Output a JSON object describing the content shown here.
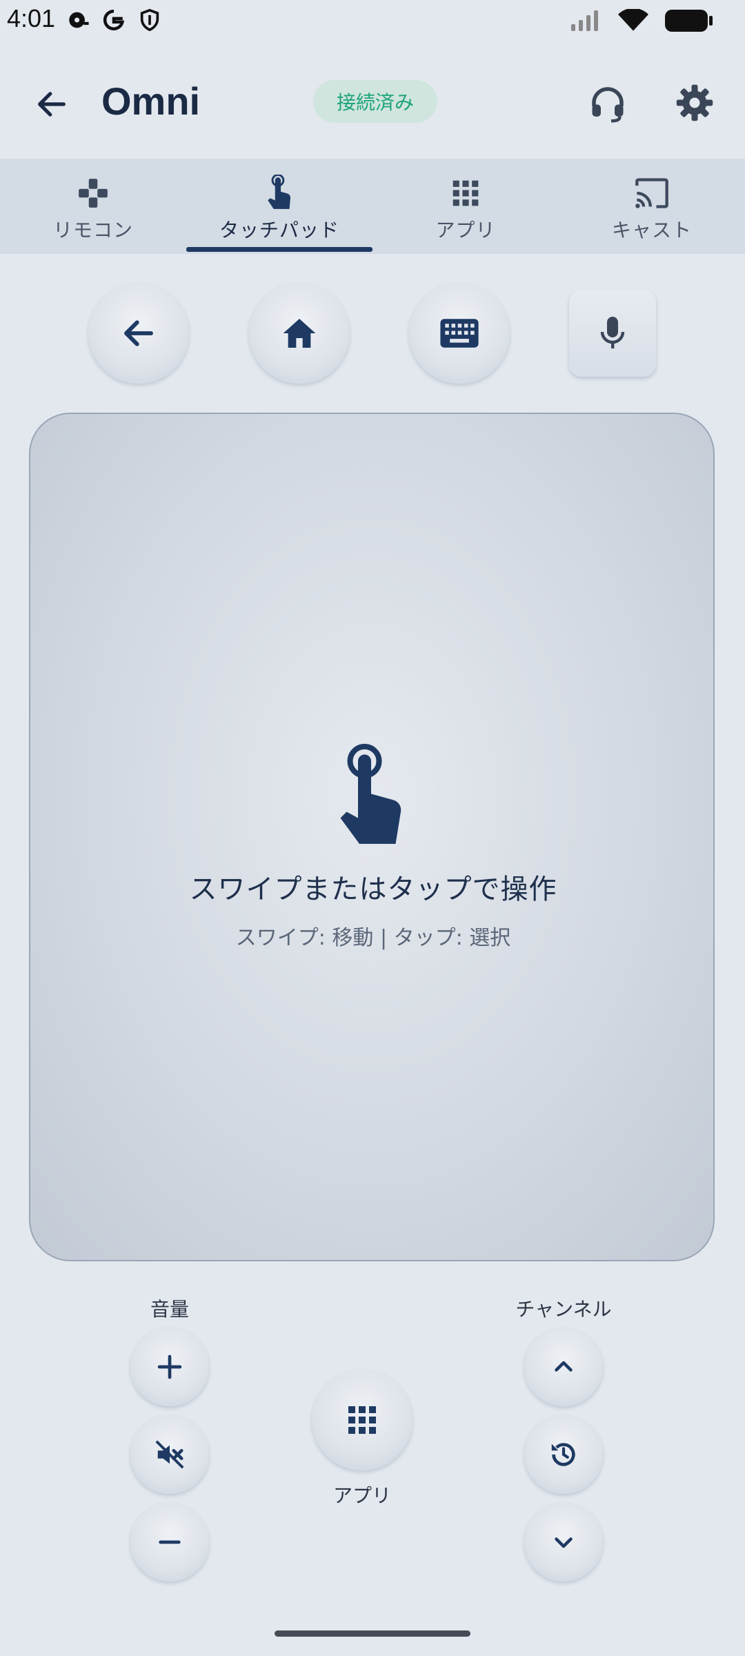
{
  "status": {
    "time": "4:01",
    "left_icons": [
      "media-icon",
      "google-icon",
      "shield-icon"
    ],
    "right_icons": [
      "signal-icon",
      "wifi-icon",
      "battery-icon"
    ]
  },
  "app_bar": {
    "title": "Omni",
    "connection_status": "接続済み",
    "accent": "#1e3a63",
    "badge_color": "#1da37a"
  },
  "tabs": [
    {
      "label": "リモコン",
      "icon": "gamepad-icon",
      "active": false
    },
    {
      "label": "タッチパッド",
      "icon": "touch-icon",
      "active": true
    },
    {
      "label": "アプリ",
      "icon": "apps-grid-icon",
      "active": false
    },
    {
      "label": "キャスト",
      "icon": "cast-icon",
      "active": false
    }
  ],
  "top_actions": [
    "back-icon",
    "home-icon",
    "keyboard-icon",
    "mic-icon"
  ],
  "touchpad": {
    "title": "スワイプまたはタップで操作",
    "hint": "スワイプ: 移動  |  タップ: 選択"
  },
  "controls": {
    "volume_label": "音量",
    "channel_label": "チャンネル",
    "apps_label": "アプリ"
  }
}
